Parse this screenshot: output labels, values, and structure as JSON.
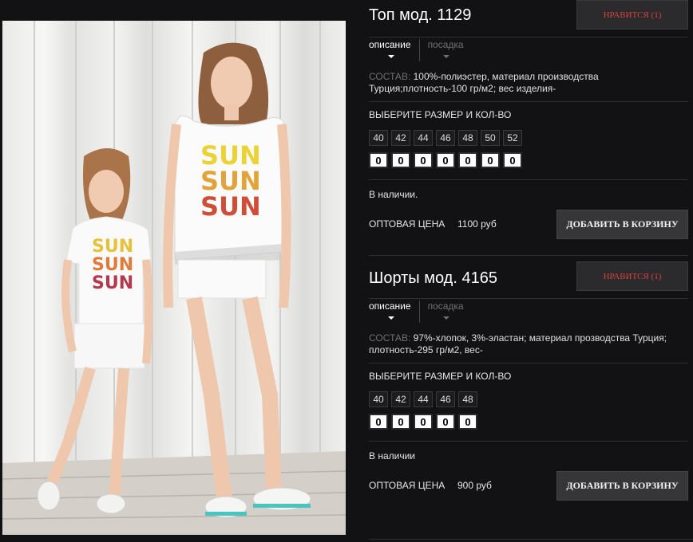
{
  "products": [
    {
      "title": "Топ мод. 1129",
      "like_label": "НРАВИТСЯ (1)",
      "tabs": [
        "описание",
        "посадка"
      ],
      "composition_label": "СОСТАВ:",
      "composition_text": "100%-полиэстер, материал производства Турция;плотность-100 гр/м2; вес изделия-",
      "size_heading": "ВЫБЕРИТЕ РАЗМЕР И КОЛ-ВО",
      "sizes": [
        "40",
        "42",
        "44",
        "46",
        "48",
        "50",
        "52"
      ],
      "quantities": [
        "0",
        "0",
        "0",
        "0",
        "0",
        "0",
        "0"
      ],
      "stock": "В наличии.",
      "price_label": "ОПТОВАЯ ЦЕНА",
      "price": "1100 руб",
      "cart_label": "ДОБАВИТЬ В КОРЗИНУ"
    },
    {
      "title": "Шорты мод. 4165",
      "like_label": "НРАВИТСЯ (1)",
      "tabs": [
        "описание",
        "посадка"
      ],
      "composition_label": "СОСТАВ:",
      "composition_text": "97%-хлопок, 3%-эластан; материал прозводства Турция; плотность-295 гр/м2, вес-",
      "size_heading": "ВЫБЕРИТЕ РАЗМЕР И КОЛ-ВО",
      "sizes": [
        "40",
        "42",
        "44",
        "46",
        "48"
      ],
      "quantities": [
        "0",
        "0",
        "0",
        "0",
        "0"
      ],
      "stock": "В наличии",
      "price_label": "ОПТОВАЯ ЦЕНА",
      "price": "900 руб",
      "cart_label": "ДОБАВИТЬ В КОРЗИНУ"
    }
  ],
  "photo": {
    "print_text": "SUN"
  },
  "colors": {
    "background": "#121214",
    "like_text": "#d8413c",
    "button_bg": "#363638"
  }
}
